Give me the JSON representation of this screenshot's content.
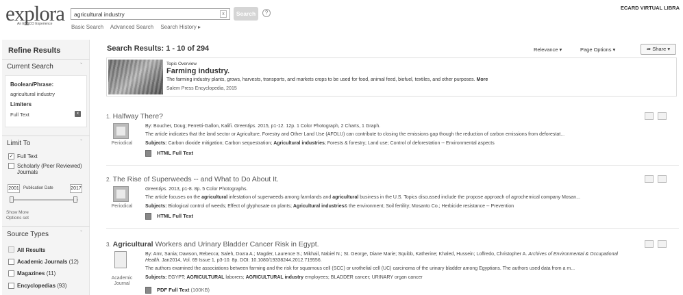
{
  "header": {
    "logo_text": "explora",
    "logo_sub": "An EBSCO Experience",
    "search_value": "agricultural industry",
    "search_button": "Search",
    "help": "?",
    "clear": "x",
    "links": [
      "Basic Search",
      "Advanced Search",
      "Search History ▸"
    ],
    "org_name": "ECARD VIRTUAL LIBRA"
  },
  "sidebar": {
    "title": "Refine Results",
    "current_search": {
      "heading": "Current Search",
      "boolean_label": "Boolean/Phrase:",
      "term": "agricultural industry",
      "limiters_label": "Limiters",
      "limiter": "Full Text",
      "remove": "x"
    },
    "limit_to": {
      "heading": "Limit To",
      "full_text": "Full Text",
      "full_text_checked": "✓",
      "scholarly": "Scholarly (Peer Reviewed)",
      "scholarly_2": "Journals",
      "date_from": "2001",
      "date_label": "Publication Date",
      "date_to": "2017",
      "show_more": "Show More",
      "options_set": "Options set"
    },
    "source_types": {
      "heading": "Source Types",
      "all": "All Results",
      "items": [
        {
          "label": "Academic Journals",
          "count": "(12)"
        },
        {
          "label": "Magazines",
          "count": "(11)"
        },
        {
          "label": "Encyclopedias",
          "count": "(93)"
        }
      ]
    }
  },
  "main": {
    "results_title": "Search Results: 1 - 10 of 294",
    "relevance": "Relevance ▾",
    "page_options": "Page Options ▾",
    "share": "Share ▾",
    "topic": {
      "label": "Topic Overview",
      "name": "Farming industry.",
      "desc": "The farming industry plants, grows, harvests, transports, and markets crops to be used for food, animal feed, biofuel, textiles, and other purposes.",
      "more": "More",
      "source": "Salem Press Encyclopedia, 2015"
    },
    "results": [
      {
        "num": "1.",
        "title_pre": "",
        "title_hl": "",
        "title_rest": "Halfway There?",
        "byline_pre": "By: Boucher, Doug; Ferretti-Gallon, Kalifi.",
        "byline_src": "Greentips.",
        "byline_post": "2015, p1-12. 12p. 1 Color Photograph, 2 Charts, 1 Graph.",
        "abstract": "The article indicates that the land sector or Agriculture, Forestry and Other Land Use (AFOLU) can contribute to closing the emissions gap though the reduction of carbon emissions from deforestat...",
        "subjects_label": "Subjects:",
        "subjects_pre": "Carbon dioxide mitigation; Carbon sequestration;",
        "subjects_hl": "Agricultural industries",
        "subjects_post": "; Forests & forestry; Land use; Control of deforestation -- Environmental aspects",
        "type": "Periodical",
        "fulltext": "HTML Full Text"
      },
      {
        "num": "2.",
        "title_pre": "",
        "title_hl": "",
        "title_rest": "The Rise of Superweeds -- and What to Do About It.",
        "byline_pre": "",
        "byline_src": "Greentips.",
        "byline_post": "2013, p1-8. 8p. 5 Color Photographs.",
        "abstract_pre": "The article focuses on the",
        "abstract_hl1": "agricultural",
        "abstract_mid": "infestation of superweeds among farmlands and",
        "abstract_hl2": "agricultural",
        "abstract_post": "business in the U.S. Topics discussed include the propose approach of agrochemical company Mosan...",
        "subjects_label": "Subjects:",
        "subjects_pre": "Biological control of weeds; Effect of glyphosate on plants;",
        "subjects_hl": "Agricultural industries",
        "subjects_post": "& the environment; Soil fertility; Mosanto Co.; Herbicide resistance -- Prevention",
        "type": "Periodical",
        "fulltext": "HTML Full Text"
      },
      {
        "num": "3.",
        "title_hl": "Agricultural",
        "title_rest": " Workers and Urinary Bladder Cancer Risk in Egypt.",
        "byline_pre": "By: Amr, Sania; Dawson, Rebecca; Saleh, Doa'a A.; Magder, Laurence S.; Mikhail, Nabiel N.; St. George, Diane Marie; Squibb, Katherine; Khaled, Hussein; Loffredo, Christopher A.",
        "byline_src": "Archives of Environmental & Occupational",
        "byline_line2_src": "Health.",
        "byline_line2": "Jan2014, Vol. 69 Issue 1, p3-10. 8p. DOI: 10.1080/19338244.2012.719556.",
        "abstract": "The authors examined the associations between farming and the risk for squamous cell (SCC) or urothelial cell (UC) carcinoma of the urinary bladder among Egyptians. The authors used data from a m...",
        "subjects_label": "Subjects:",
        "subjects_pre": "EGYPT;",
        "subjects_hl": "AGRICULTURAL",
        "subjects_mid": "laborers;",
        "subjects_hl2": "AGRICULTURAL industry",
        "subjects_post": "employees; BLADDER cancer; URINARY organ cancer",
        "type": "Academic Journal",
        "type_1": "Academic",
        "type_2": "Journal",
        "fulltext": "PDF Full Text",
        "fulltext_size": "(100KB)"
      }
    ]
  }
}
